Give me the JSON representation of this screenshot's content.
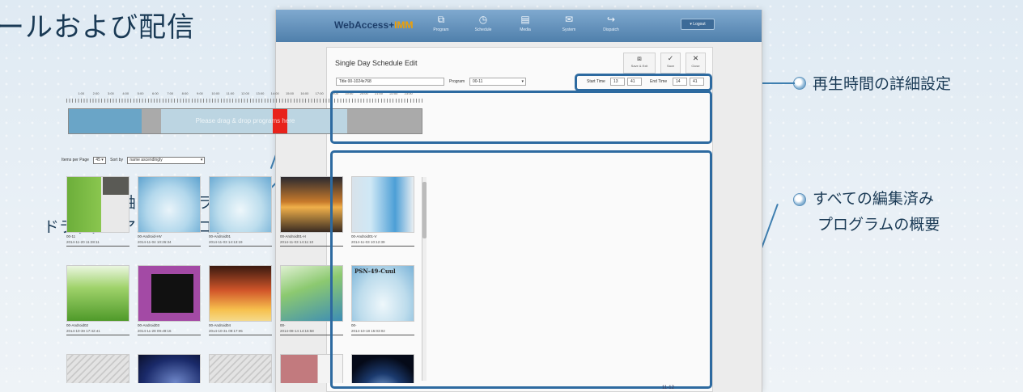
{
  "heading": "ールおよび配信",
  "callouts": {
    "drag_drop": [
      "時間軸にプログラムを",
      "ドラッグ・アンド・ドロップ"
    ],
    "time_detail": "再生時間の詳細設定",
    "overview": [
      "すべての編集済み",
      "プログラムの概要"
    ]
  },
  "app": {
    "logo_main": "WebAccess+",
    "logo_suffix": "IMM",
    "nav": [
      "Program",
      "Schedule",
      "Media",
      "System",
      "Dispatch"
    ],
    "logout": "▾ Logout",
    "title": "Single Day Schedule Edit",
    "toolbar": {
      "save_exit": "Save & Exit",
      "save": "Save",
      "close": "Close"
    },
    "title_field": "Title 00-1024x768",
    "program_label": "Program",
    "program_value": "00-11",
    "start_label": "Start Time",
    "start_h": "13",
    "start_m": "41",
    "end_label": "End Time",
    "end_h": "14",
    "end_m": "41",
    "ruler_ticks": [
      "1:00",
      "2:00",
      "3:00",
      "4:00",
      "5:00",
      "6:00",
      "7:00",
      "8:00",
      "9:00",
      "10:00",
      "11:00",
      "12:00",
      "13:00",
      "14:00",
      "15:00",
      "16:00",
      "17:00",
      "18:00",
      "19:00",
      "20:00",
      "21:00",
      "22:00",
      "23:00"
    ],
    "drop_hint": "Please drag & drop programs here",
    "items_per_page_label": "Items per Page",
    "items_per_page": "45",
    "sort_label": "Sort by",
    "sort_value": "name ascendingly",
    "items": [
      {
        "name": "00-11",
        "date": "2014-11-20 11:28:11"
      },
      {
        "name": "00-Android-HV",
        "date": "2014-11-04 10:26:34"
      },
      {
        "name": "00-Android01",
        "date": "2014-11-03 14:13:19"
      },
      {
        "name": "00-Android01-H",
        "date": "2014-11-03 14:11:10"
      },
      {
        "name": "00-Android01-V",
        "date": "2014-11-03 10:12:39"
      },
      {
        "name": "00-Android02",
        "date": "2014-10-30 17:42:41"
      },
      {
        "name": "00-Android03",
        "date": "2014-11-28 09:49:16"
      },
      {
        "name": "00-Android04",
        "date": "2014-10-31 09:17:05"
      },
      {
        "name": "00-",
        "date": "2014-08-14 14:15:58"
      },
      {
        "name": "00-",
        "date": "2014-10-18 15:03:02"
      }
    ],
    "psn_label": "PSN-49-Cuul"
  },
  "footer_number": "11-12"
}
